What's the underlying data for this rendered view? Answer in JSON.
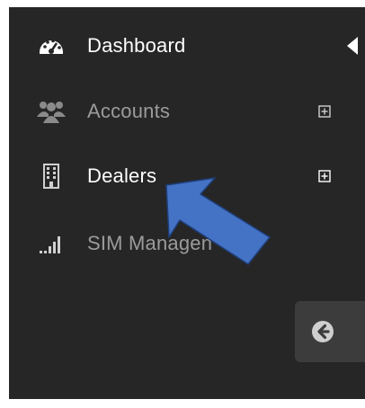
{
  "sidebar": {
    "items": [
      {
        "label": "Dashboard",
        "icon": "dashboard-gauge-icon",
        "active": true,
        "expandable": false
      },
      {
        "label": "Accounts",
        "icon": "users-group-icon",
        "active": false,
        "expandable": true
      },
      {
        "label": "Dealers",
        "icon": "building-icon",
        "active": false,
        "expandable": true
      },
      {
        "label": "SIM Managen",
        "icon": "signal-bars-icon",
        "active": false,
        "expandable": false
      }
    ],
    "collapse_icon": "arrow-left-circle-icon"
  },
  "colors": {
    "sidebar_bg": "#262626",
    "active_text": "#ffffff",
    "muted_text": "#9b9b9b",
    "annotation_arrow": "#4472c4"
  },
  "overlay": {
    "annotation_arrow_icon": "annotation-arrow-icon"
  }
}
